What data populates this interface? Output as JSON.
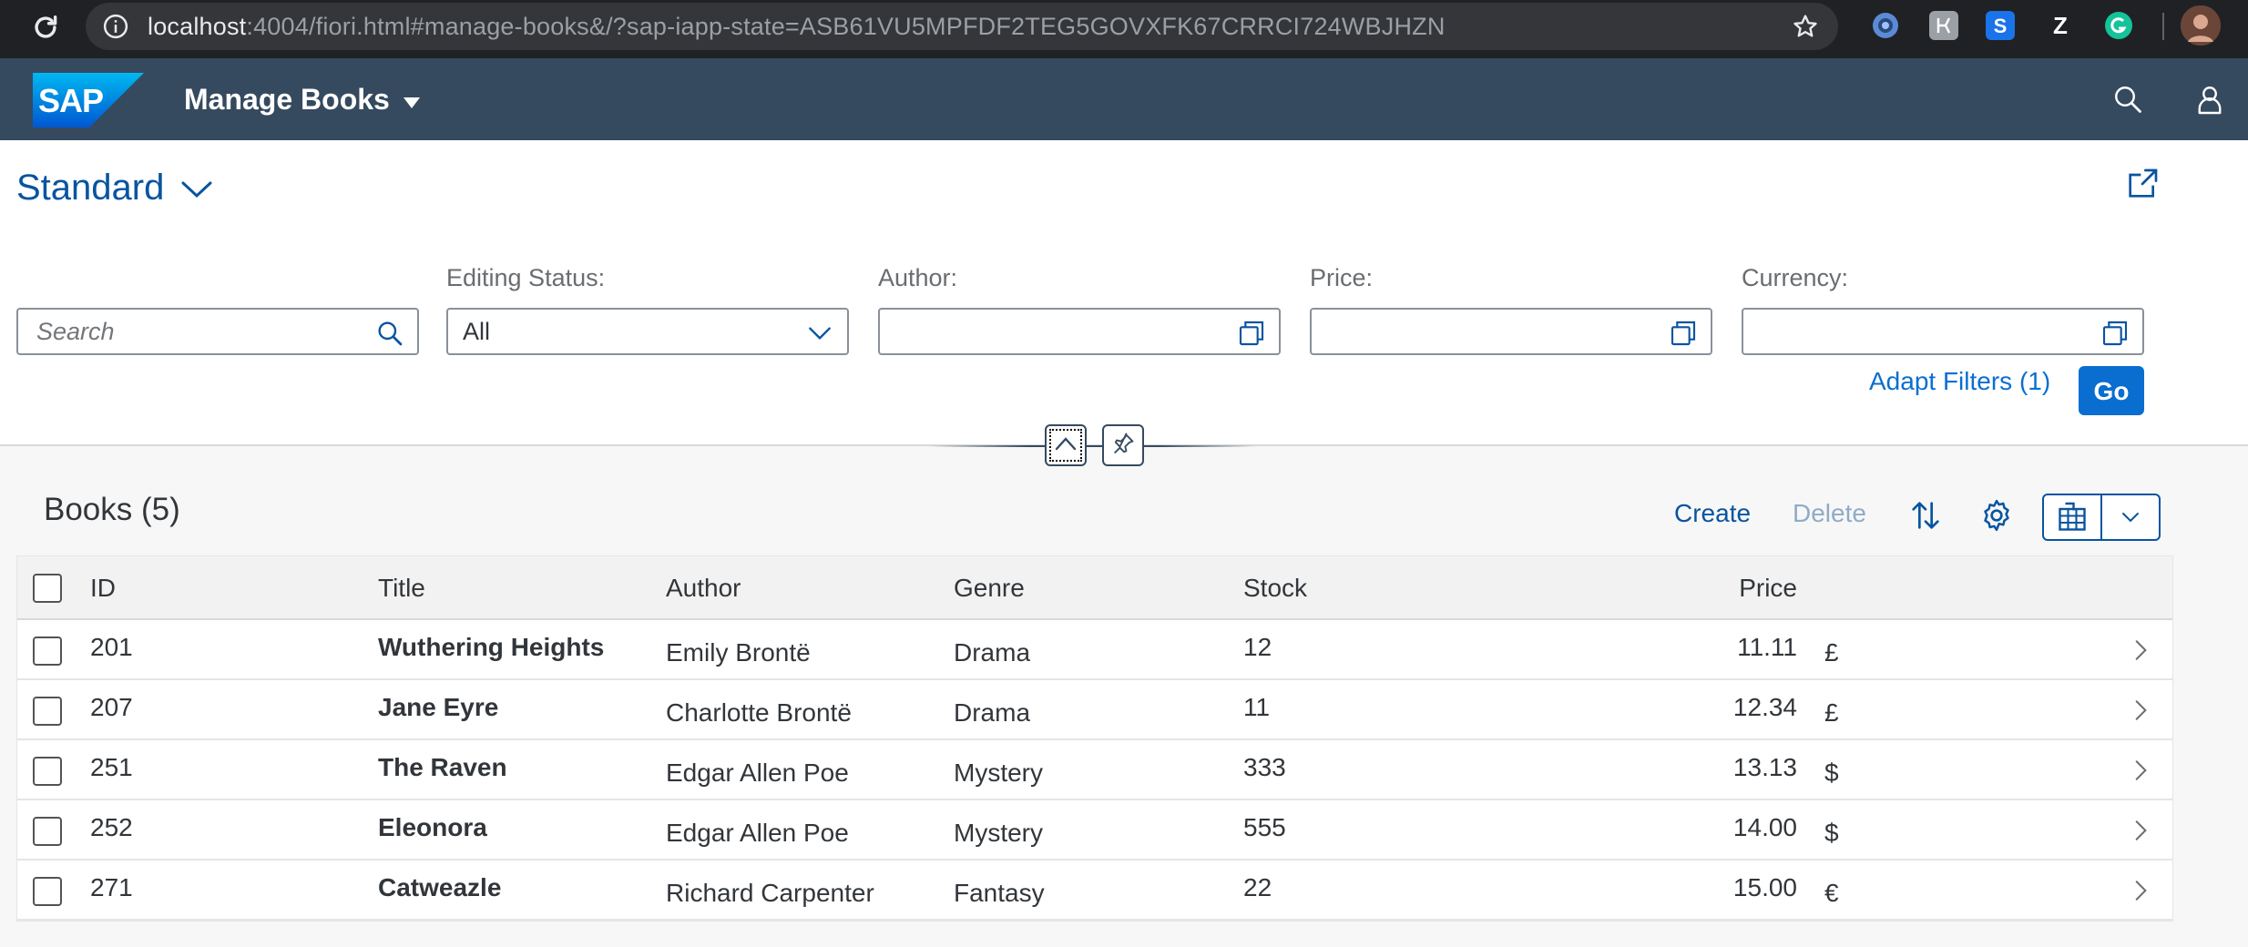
{
  "browser": {
    "url_host": "localhost",
    "url_rest": ":4004/fiori.html#manage-books&/?sap-iapp-state=ASB61VU5MPFDF2TEG5GOVXFK67CRRCI724WBJHZN"
  },
  "shell": {
    "app_title": "Manage Books"
  },
  "filterbar": {
    "variant": "Standard",
    "search_placeholder": "Search",
    "editing_status_label": "Editing Status:",
    "editing_status_value": "All",
    "author_label": "Author:",
    "price_label": "Price:",
    "currency_label": "Currency:",
    "adapt_filters": "Adapt Filters (1)",
    "go": "Go"
  },
  "table": {
    "title": "Books (5)",
    "create": "Create",
    "delete": "Delete",
    "columns": [
      "ID",
      "Title",
      "Author",
      "Genre",
      "Stock",
      "Price"
    ],
    "rows": [
      {
        "id": "201",
        "title": "Wuthering Heights",
        "author": "Emily Brontë",
        "genre": "Drama",
        "stock": "12",
        "price": "11.11",
        "currency": "£"
      },
      {
        "id": "207",
        "title": "Jane Eyre",
        "author": "Charlotte Brontë",
        "genre": "Drama",
        "stock": "11",
        "price": "12.34",
        "currency": "£"
      },
      {
        "id": "251",
        "title": "The Raven",
        "author": "Edgar Allen Poe",
        "genre": "Mystery",
        "stock": "333",
        "price": "13.13",
        "currency": "$"
      },
      {
        "id": "252",
        "title": "Eleonora",
        "author": "Edgar Allen Poe",
        "genre": "Mystery",
        "stock": "555",
        "price": "14.00",
        "currency": "$"
      },
      {
        "id": "271",
        "title": "Catweazle",
        "author": "Richard Carpenter",
        "genre": "Fantasy",
        "stock": "22",
        "price": "15.00",
        "currency": "€"
      }
    ]
  },
  "icons": {
    "reload": "reload-icon",
    "info": "info-icon",
    "bookmark": "star-icon",
    "search": "search-icon",
    "user": "user-icon",
    "share": "share-icon",
    "value_help": "value-help-icon",
    "sort": "sort-icon",
    "settings": "gear-icon",
    "export": "export-icon"
  },
  "colors": {
    "shell_bg": "#354a5f",
    "brand_blue": "#0a6ed1",
    "link_blue": "#0854a0",
    "disabled_blue": "#8fabc7"
  }
}
